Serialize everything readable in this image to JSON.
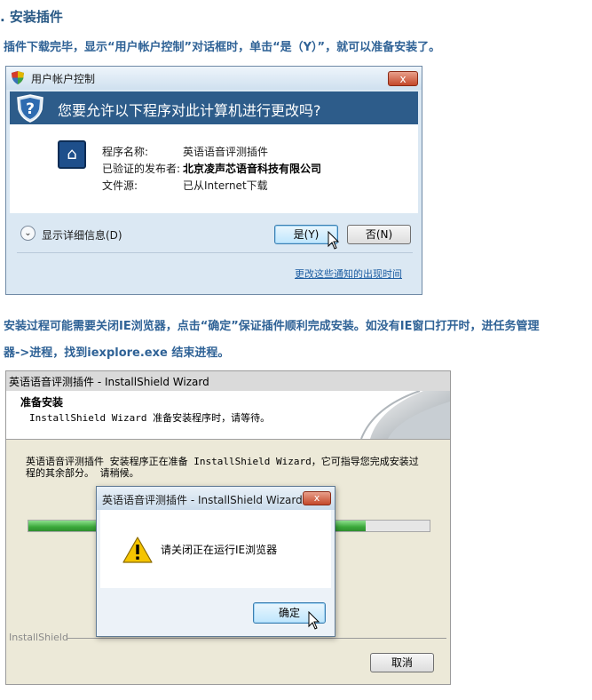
{
  "section": {
    "heading": ". 安装插件",
    "para1": "插件下载完毕，显示“用户帐户控制”对话框时，单击“是（Y）”，就可以准备安装了。",
    "para2_line1": "安装过程可能需要关闭IE浏览器，点击“确定”保证插件顺利完成安装。如没有IE窗口打开时，进任务管理",
    "para2_line2": "器->进程，找到iexplore.exe 结束进程。"
  },
  "uac": {
    "title": "用户帐户控制",
    "close_label": "x",
    "question": "您要允许以下程序对此计算机进行更改吗?",
    "program_label": "程序名称:",
    "program_value": "英语语音评测插件",
    "publisher_label": "已验证的发布者:",
    "publisher_value": "北京凌声芯语音科技有限公司",
    "source_label": "文件源:",
    "source_value": "已从Internet下载",
    "details_label": "显示详细信息(D)",
    "yes_label": "是(Y)",
    "no_label": "否(N)",
    "change_link": "更改这些通知的出现时间",
    "accent_color": "#2d5c8a"
  },
  "installshield": {
    "title": "英语语音评测插件 - InstallShield Wizard",
    "header_title": "准备安装",
    "header_subtitle": "InstallShield Wizard 准备安装程序时，请等待。",
    "body_text": "英语语音评测插件 安装程序正在准备 InstallShield Wizard，它可指导您完成安装过程的其余部分。 请稍候。",
    "progress_fraction": 0.84,
    "brand": "InstallShield",
    "cancel_label": "取消"
  },
  "message_box": {
    "title": "英语语音评测插件 - InstallShield Wizard",
    "close_label": "x",
    "text": "请关闭正在运行IE浏览器",
    "ok_label": "确定",
    "icon": "warning-icon"
  }
}
